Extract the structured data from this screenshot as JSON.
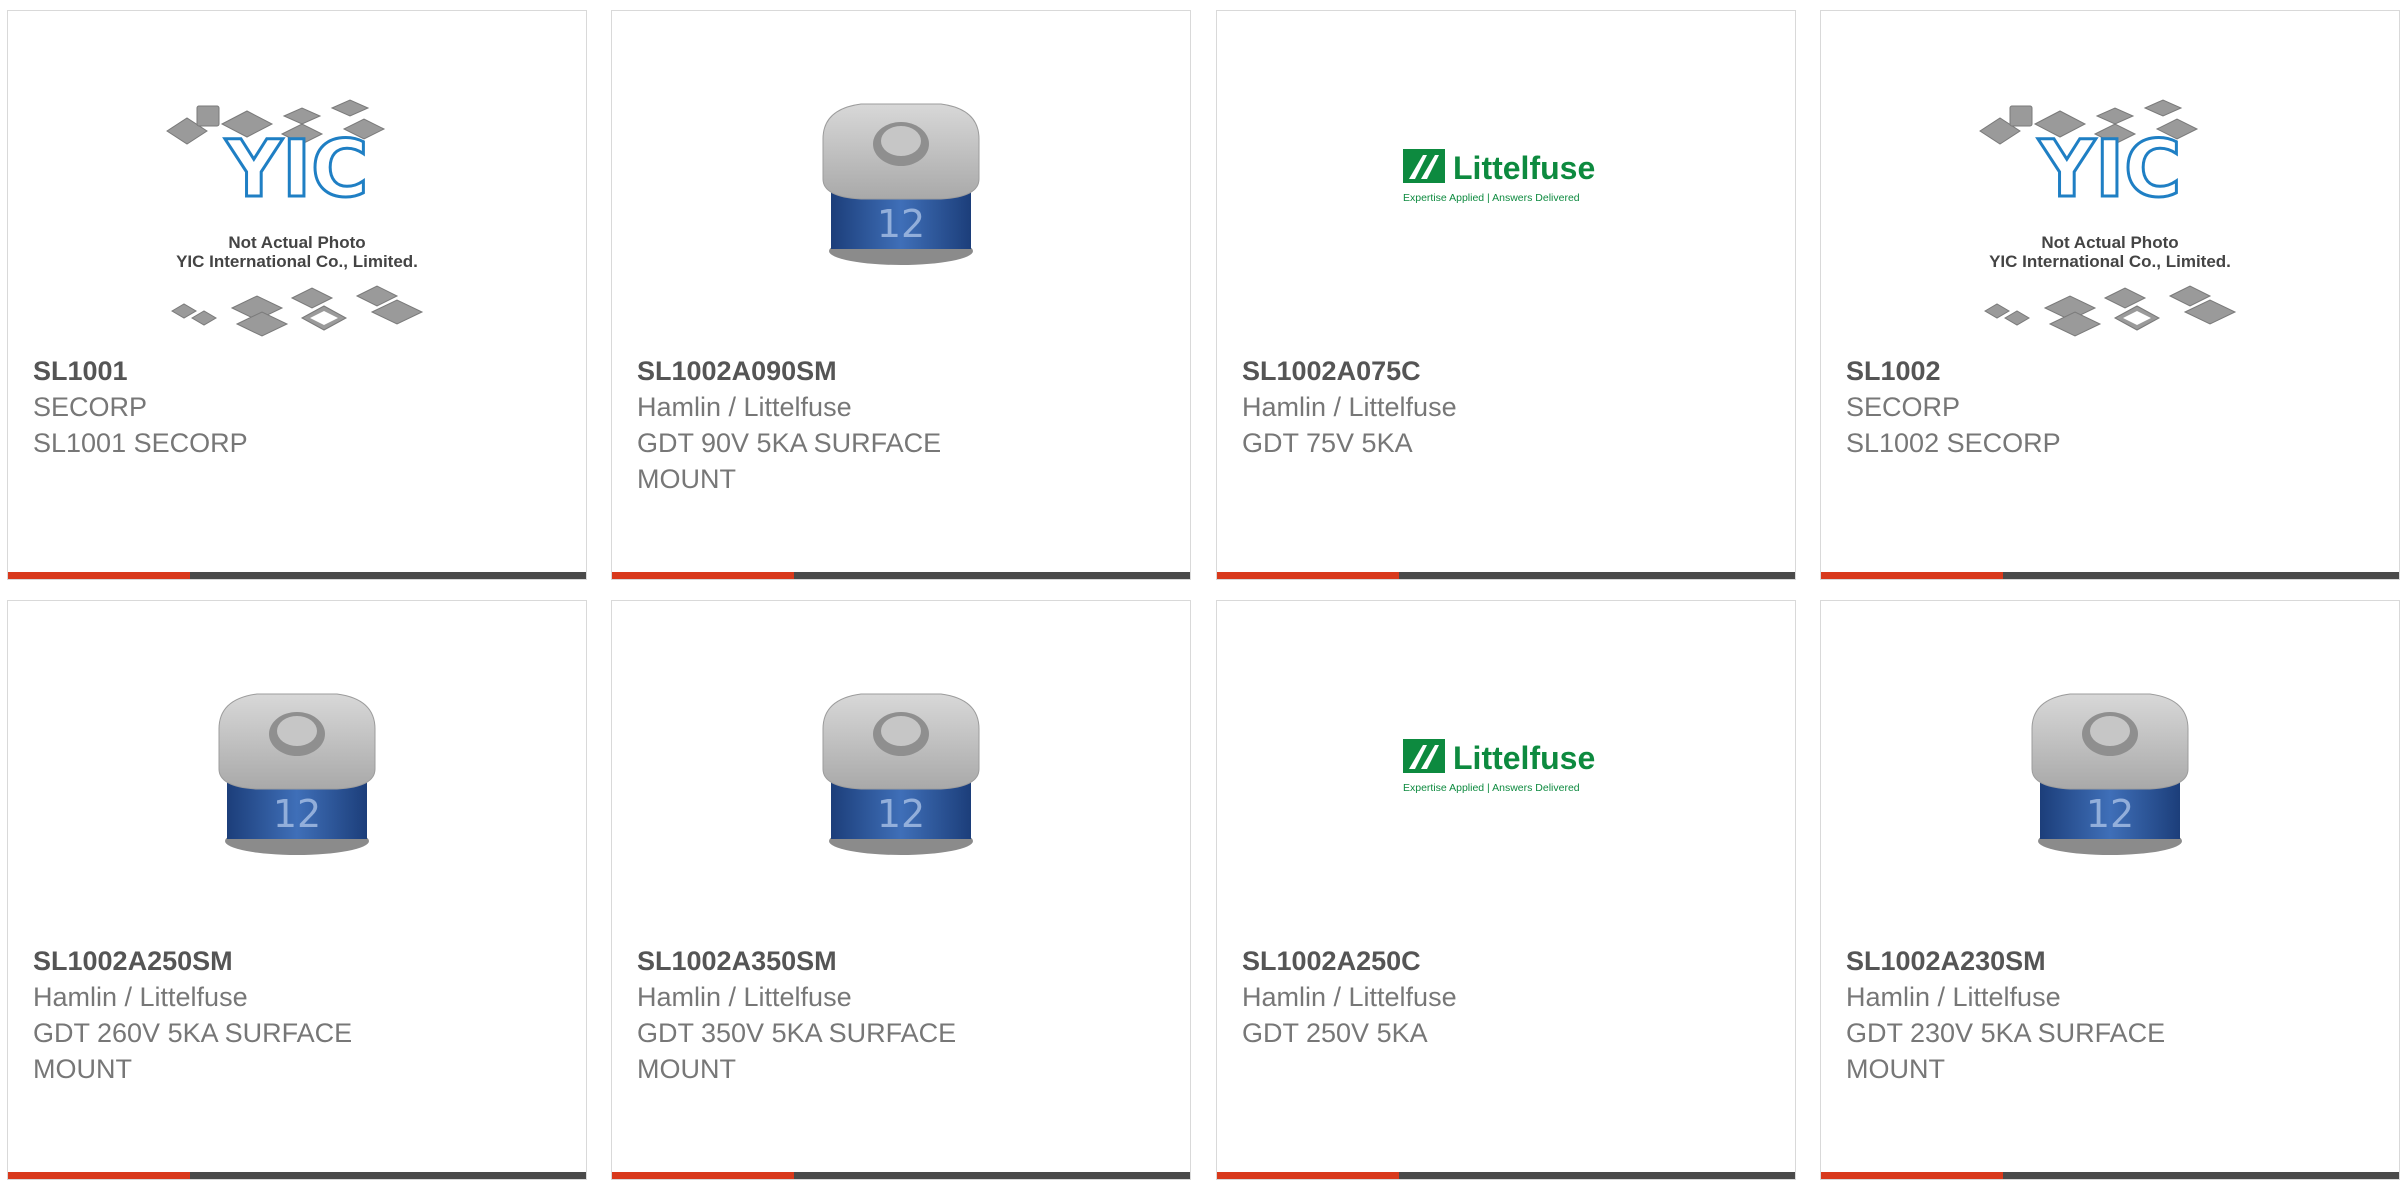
{
  "products": [
    {
      "part_number": "SL1001",
      "manufacturer": "SECORP",
      "description": "SL1001 SECORP",
      "image": "yic-placeholder"
    },
    {
      "part_number": "SL1002A090SM",
      "manufacturer": "Hamlin / Littelfuse",
      "description": "GDT 90V 5KA SURFACE MOUNT",
      "image": "gdt-component"
    },
    {
      "part_number": "SL1002A075C",
      "manufacturer": "Hamlin / Littelfuse",
      "description": "GDT 75V 5KA",
      "image": "littelfuse-logo"
    },
    {
      "part_number": "SL1002",
      "manufacturer": "SECORP",
      "description": "SL1002 SECORP",
      "image": "yic-placeholder"
    },
    {
      "part_number": "SL1002A250SM",
      "manufacturer": "Hamlin / Littelfuse",
      "description": "GDT 260V 5KA SURFACE MOUNT",
      "image": "gdt-component"
    },
    {
      "part_number": "SL1002A350SM",
      "manufacturer": "Hamlin / Littelfuse",
      "description": "GDT 350V 5KA SURFACE MOUNT",
      "image": "gdt-component"
    },
    {
      "part_number": "SL1002A250C",
      "manufacturer": "Hamlin / Littelfuse",
      "description": "GDT 250V 5KA",
      "image": "littelfuse-logo"
    },
    {
      "part_number": "SL1002A230SM",
      "manufacturer": "Hamlin / Littelfuse",
      "description": "GDT 230V 5KA SURFACE MOUNT",
      "image": "gdt-component"
    }
  ],
  "placeholder": {
    "line1": "Not Actual Photo",
    "line2": "YIC International Co., Limited.",
    "brand": "YIC"
  },
  "logo": {
    "brand": "Littelfuse",
    "tagline": "Expertise Applied | Answers Delivered"
  },
  "gdt_marking": "12",
  "colors": {
    "accent": "#d8391c",
    "bar": "#4a4a4a",
    "logo_green": "#0d8a3f",
    "yic_blue": "#1f7fc4"
  }
}
